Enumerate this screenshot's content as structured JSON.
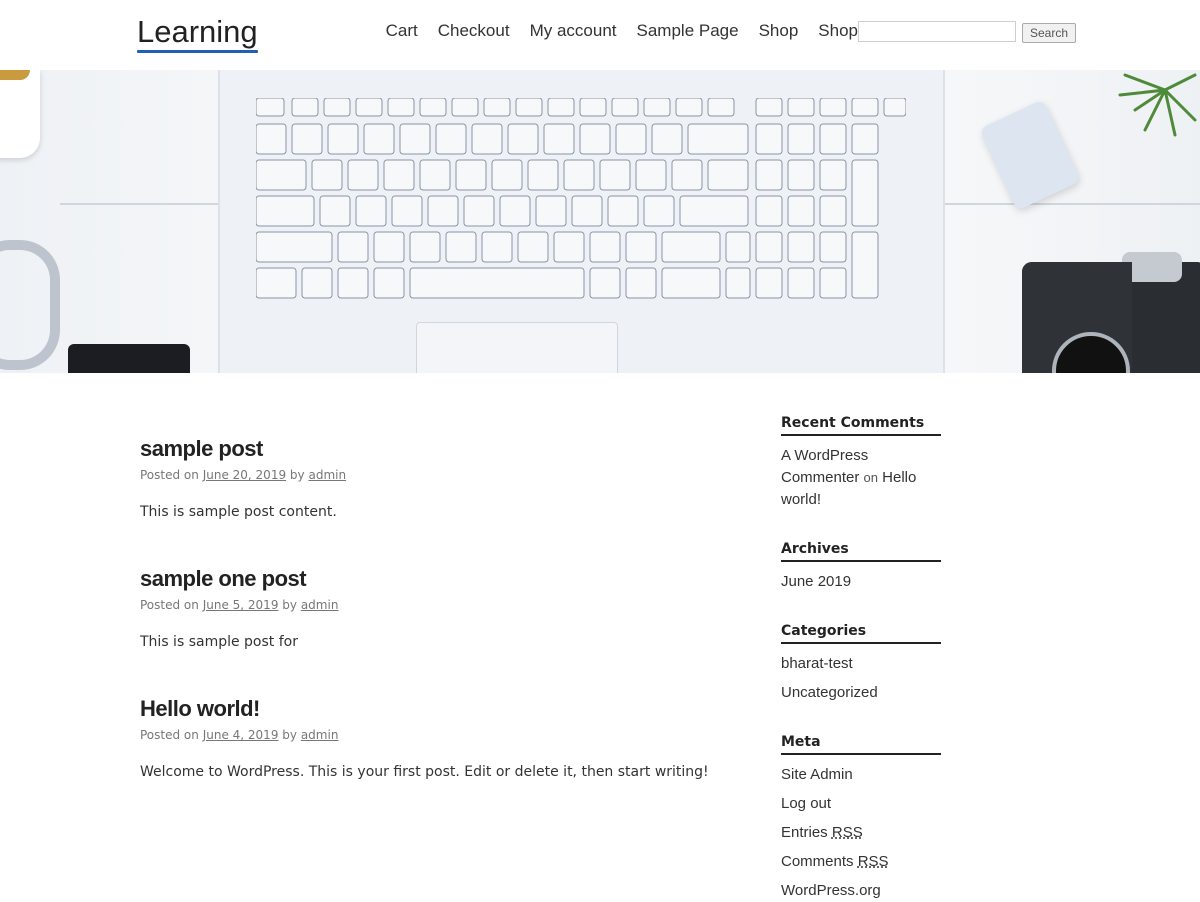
{
  "header": {
    "site_title": "Learning",
    "nav": [
      "Cart",
      "Checkout",
      "My account",
      "Sample Page",
      "Shop",
      "Shop"
    ],
    "search_placeholder": "",
    "search_button": "Search"
  },
  "posts": [
    {
      "title": "sample post",
      "posted_on_label": "Posted on",
      "date": "June 20, 2019",
      "by_label": "by",
      "author": "admin",
      "content": "This is sample post content."
    },
    {
      "title": "sample one post",
      "posted_on_label": "Posted on",
      "date": "June 5, 2019",
      "by_label": "by",
      "author": "admin",
      "content": "This is sample post for"
    },
    {
      "title": "Hello world!",
      "posted_on_label": "Posted on",
      "date": "June 4, 2019",
      "by_label": "by",
      "author": "admin",
      "content": "Welcome to WordPress. This is your first post. Edit or delete it, then start writing!"
    }
  ],
  "sidebar": {
    "recent_comments": {
      "title": "Recent Comments",
      "author": "A WordPress Commenter",
      "on": "on",
      "post": "Hello world!"
    },
    "archives": {
      "title": "Archives",
      "items": [
        "June 2019"
      ]
    },
    "categories": {
      "title": "Categories",
      "items": [
        "bharat-test",
        "Uncategorized"
      ]
    },
    "meta": {
      "title": "Meta",
      "site_admin": "Site Admin",
      "log_out": "Log out",
      "entries_prefix": "Entries",
      "comments_prefix": "Comments",
      "rss": "RSS",
      "wordpress_org": "WordPress.org"
    }
  },
  "hero": {
    "image": "laptop-keyboard-desk-photo"
  }
}
